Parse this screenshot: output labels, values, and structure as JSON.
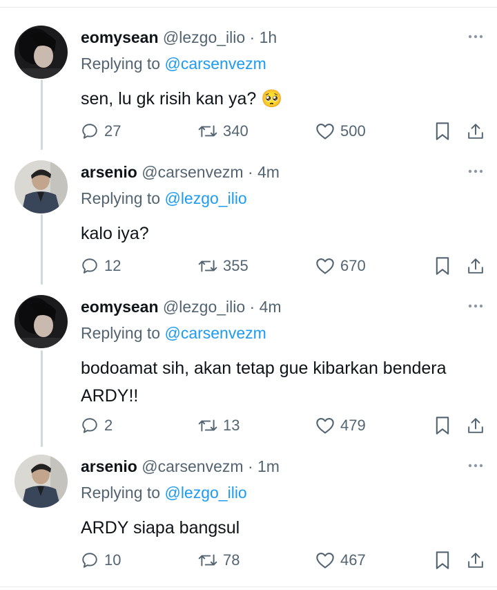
{
  "tweets": [
    {
      "name": "eomysean",
      "handle": "@lezgo_ilio",
      "sep": "·",
      "time": "1h",
      "replying_label": "Replying to",
      "replying_to": "@carsenvezm",
      "text": "sen, lu gk risih kan ya? 🥺",
      "replies": "27",
      "retweets": "340",
      "likes": "500",
      "avatar": "dark-hair-profile-photo"
    },
    {
      "name": "arsenio",
      "handle": "@carsenvezm",
      "sep": "·",
      "time": "4m",
      "replying_label": "Replying to",
      "replying_to": "@lezgo_ilio",
      "text": "kalo iya?",
      "replies": "12",
      "retweets": "355",
      "likes": "670",
      "avatar": "denim-jacket-profile-photo"
    },
    {
      "name": "eomysean",
      "handle": "@lezgo_ilio",
      "sep": "·",
      "time": "4m",
      "replying_label": "Replying to",
      "replying_to": "@carsenvezm",
      "text": "bodoamat sih, akan tetap gue kibarkan bendera ARDY!!",
      "replies": "2",
      "retweets": "13",
      "likes": "479",
      "avatar": "dark-hair-profile-photo"
    },
    {
      "name": "arsenio",
      "handle": "@carsenvezm",
      "sep": "·",
      "time": "1m",
      "replying_label": "Replying to",
      "replying_to": "@lezgo_ilio",
      "text": "ARDY siapa bangsul",
      "replies": "10",
      "retweets": "78",
      "likes": "467",
      "avatar": "denim-jacket-profile-photo"
    }
  ],
  "icons": {
    "reply": "reply-icon",
    "retweet": "retweet-icon",
    "like": "heart-icon",
    "bookmark": "bookmark-icon",
    "share": "share-icon",
    "more": "more-icon"
  },
  "colors": {
    "text": "#0f1419",
    "secondary": "#536471",
    "link": "#1d9bf0",
    "divider": "#e7e9ea"
  }
}
